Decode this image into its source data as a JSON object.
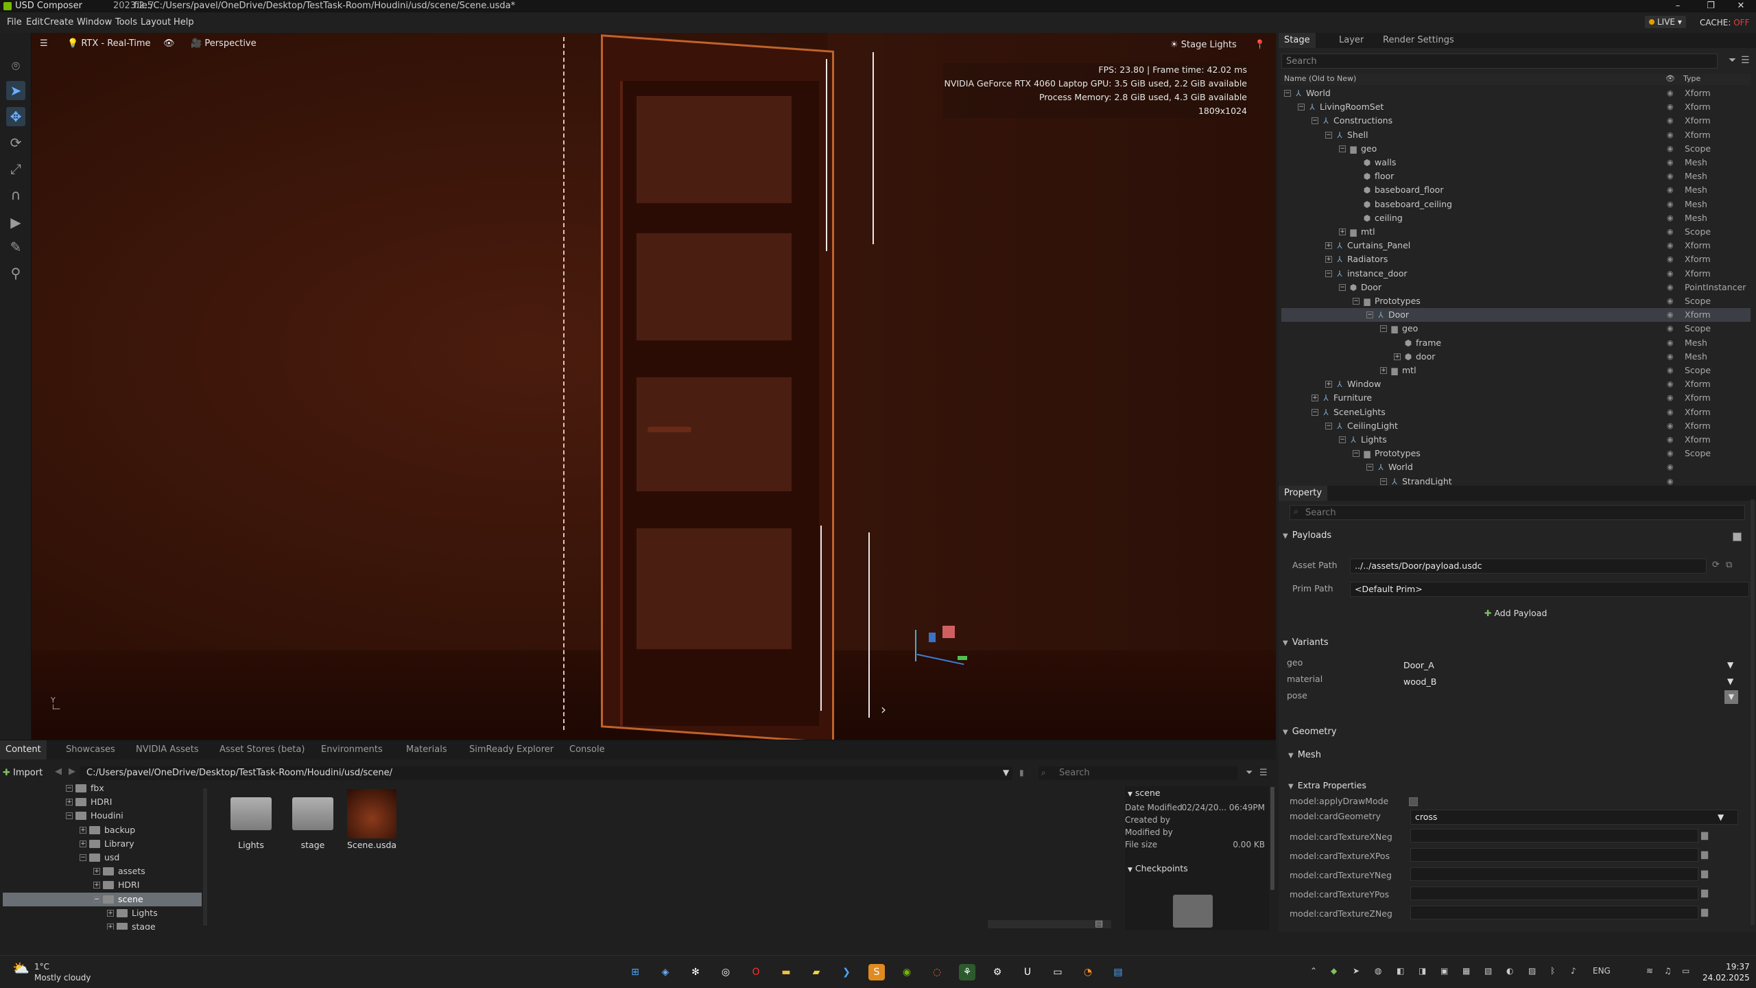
{
  "window": {
    "app_name": "USD Composer",
    "version": "2023.2.5",
    "file_path": "file:/C:/Users/pavel/OneDrive/Desktop/TestTask-Room/Houdini/usd/scene/Scene.usda*",
    "minimize": "–",
    "maximize": "❐",
    "close": "✕"
  },
  "menu": [
    "File",
    "Edit",
    "Create",
    "Window",
    "Tools",
    "Layout",
    "Help"
  ],
  "live": {
    "label": "LIVE",
    "cache_label": "CACHE:",
    "cache_state": "OFF"
  },
  "viewport": {
    "renderer": "RTX - Real-Time",
    "camera": "Perspective",
    "stage_lights": "Stage Lights",
    "stats": [
      "FPS: 23.80  |  Frame time: 42.02 ms",
      "NVIDIA GeForce RTX 4060 Laptop GPU: 3.5 GiB used, 2.2 GiB available",
      "Process Memory: 2.8 GiB used, 4.3 GiB available",
      "1809x1024"
    ],
    "axis_label": "Y"
  },
  "stage": {
    "tabs": [
      "Stage",
      "Layer",
      "Render Settings"
    ],
    "search_placeholder": "Search",
    "col_name": "Name (Old to New)",
    "col_type": "Type",
    "rows": [
      {
        "name": "World",
        "type": "Xform",
        "depth": 0,
        "exp": "−",
        "icon": "xform"
      },
      {
        "name": "LivingRoomSet",
        "type": "Xform",
        "depth": 1,
        "exp": "−",
        "icon": "xform"
      },
      {
        "name": "Constructions",
        "type": "Xform",
        "depth": 2,
        "exp": "−",
        "icon": "xform"
      },
      {
        "name": "Shell",
        "type": "Xform",
        "depth": 3,
        "exp": "−",
        "icon": "xform"
      },
      {
        "name": "geo",
        "type": "Scope",
        "depth": 4,
        "exp": "−",
        "icon": "folder"
      },
      {
        "name": "walls",
        "type": "Mesh",
        "depth": 5,
        "exp": "",
        "icon": "mesh"
      },
      {
        "name": "floor",
        "type": "Mesh",
        "depth": 5,
        "exp": "",
        "icon": "mesh"
      },
      {
        "name": "baseboard_floor",
        "type": "Mesh",
        "depth": 5,
        "exp": "",
        "icon": "mesh"
      },
      {
        "name": "baseboard_ceiling",
        "type": "Mesh",
        "depth": 5,
        "exp": "",
        "icon": "mesh"
      },
      {
        "name": "ceiling",
        "type": "Mesh",
        "depth": 5,
        "exp": "",
        "icon": "mesh"
      },
      {
        "name": "mtl",
        "type": "Scope",
        "depth": 4,
        "exp": "+",
        "icon": "folder"
      },
      {
        "name": "Curtains_Panel",
        "type": "Xform",
        "depth": 3,
        "exp": "+",
        "icon": "xform"
      },
      {
        "name": "Radiators",
        "type": "Xform",
        "depth": 3,
        "exp": "+",
        "icon": "xform"
      },
      {
        "name": "instance_door",
        "type": "Xform",
        "depth": 3,
        "exp": "−",
        "icon": "xform"
      },
      {
        "name": "Door",
        "type": "PointInstancer",
        "depth": 4,
        "exp": "−",
        "icon": "mesh"
      },
      {
        "name": "Prototypes",
        "type": "Scope",
        "depth": 5,
        "exp": "−",
        "icon": "folder"
      },
      {
        "name": "Door",
        "type": "Xform",
        "depth": 6,
        "exp": "−",
        "icon": "xform",
        "selected": true
      },
      {
        "name": "geo",
        "type": "Scope",
        "depth": 7,
        "exp": "−",
        "icon": "folder"
      },
      {
        "name": "frame",
        "type": "Mesh",
        "depth": 8,
        "exp": "",
        "icon": "mesh"
      },
      {
        "name": "door",
        "type": "Mesh",
        "depth": 8,
        "exp": "+",
        "icon": "mesh"
      },
      {
        "name": "mtl",
        "type": "Scope",
        "depth": 7,
        "exp": "+",
        "icon": "folder"
      },
      {
        "name": "Window",
        "type": "Xform",
        "depth": 3,
        "exp": "+",
        "icon": "xform"
      },
      {
        "name": "Furniture",
        "type": "Xform",
        "depth": 2,
        "exp": "+",
        "icon": "xform"
      },
      {
        "name": "SceneLights",
        "type": "Xform",
        "depth": 2,
        "exp": "−",
        "icon": "xform"
      },
      {
        "name": "CeilingLight",
        "type": "Xform",
        "depth": 3,
        "exp": "−",
        "icon": "xform"
      },
      {
        "name": "Lights",
        "type": "Xform",
        "depth": 4,
        "exp": "−",
        "icon": "xform"
      },
      {
        "name": "Prototypes",
        "type": "Scope",
        "depth": 5,
        "exp": "−",
        "icon": "folder"
      },
      {
        "name": "World",
        "type": "",
        "depth": 6,
        "exp": "−",
        "icon": "xform"
      },
      {
        "name": "StrandLight",
        "type": "",
        "depth": 7,
        "exp": "−",
        "icon": "xform"
      }
    ]
  },
  "property": {
    "tab": "Property",
    "search_placeholder": "Search",
    "payloads": {
      "title": "Payloads",
      "asset_path_label": "Asset Path",
      "asset_path": "../../assets/Door/payload.usdc",
      "prim_path_label": "Prim Path",
      "prim_path": "<Default Prim>",
      "add_button": "Add Payload"
    },
    "variants": {
      "title": "Variants",
      "items": [
        {
          "label": "geo",
          "value": "Door_A"
        },
        {
          "label": "material",
          "value": "wood_B"
        },
        {
          "label": "pose",
          "value": ""
        }
      ]
    },
    "geometry_title": "Geometry",
    "mesh_title": "Mesh",
    "extra": {
      "title": "Extra Properties",
      "items": [
        {
          "label": "model:applyDrawMode",
          "kind": "checkbox",
          "value": ""
        },
        {
          "label": "model:cardGeometry",
          "kind": "dropdown",
          "value": "cross"
        },
        {
          "label": "model:cardTextureXNeg",
          "kind": "path",
          "value": ""
        },
        {
          "label": "model:cardTextureXPos",
          "kind": "path",
          "value": ""
        },
        {
          "label": "model:cardTextureYNeg",
          "kind": "path",
          "value": ""
        },
        {
          "label": "model:cardTextureYPos",
          "kind": "path",
          "value": ""
        },
        {
          "label": "model:cardTextureZNeg",
          "kind": "path",
          "value": ""
        }
      ]
    }
  },
  "content": {
    "tabs": [
      "Content",
      "Showcases",
      "NVIDIA Assets",
      "Asset Stores (beta)",
      "Environments",
      "Materials",
      "SimReady Explorer",
      "Console"
    ],
    "import_label": "Import",
    "path": "C:/Users/pavel/OneDrive/Desktop/TestTask-Room/Houdini/usd/scene/",
    "search_placeholder": "Search",
    "tree": [
      {
        "name": "fbx",
        "depth": 0,
        "exp": "−"
      },
      {
        "name": "HDRI",
        "depth": 0,
        "exp": "+"
      },
      {
        "name": "Houdini",
        "depth": 0,
        "exp": "−"
      },
      {
        "name": "backup",
        "depth": 1,
        "exp": "+"
      },
      {
        "name": "Library",
        "depth": 1,
        "exp": "+"
      },
      {
        "name": "usd",
        "depth": 1,
        "exp": "−"
      },
      {
        "name": "assets",
        "depth": 2,
        "exp": "+"
      },
      {
        "name": "HDRI",
        "depth": 2,
        "exp": "+"
      },
      {
        "name": "scene",
        "depth": 2,
        "exp": "−",
        "selected": true
      },
      {
        "name": "Lights",
        "depth": 3,
        "exp": "+"
      },
      {
        "name": "stage",
        "depth": 3,
        "exp": "+"
      }
    ],
    "assets": [
      {
        "name": "Lights",
        "kind": "folder"
      },
      {
        "name": "stage",
        "kind": "folder"
      },
      {
        "name": "Scene.usda",
        "kind": "image"
      }
    ],
    "details": {
      "title": "scene",
      "rows": [
        {
          "k": "Date Modified",
          "v": "02/24/20... 06:49PM"
        },
        {
          "k": "Created by",
          "v": ""
        },
        {
          "k": "Modified by",
          "v": ""
        },
        {
          "k": "File size",
          "v": "0.00 KB"
        }
      ],
      "checkpoints": "Checkpoints"
    }
  },
  "taskbar": {
    "temp": "1°C",
    "weather": "Mostly cloudy",
    "lang": "ENG",
    "time": "19:37",
    "date": "24.02.2025"
  },
  "colors": {
    "accent": "#76b900",
    "selection": "#3b3f45",
    "door_outline": "#c0632a"
  }
}
